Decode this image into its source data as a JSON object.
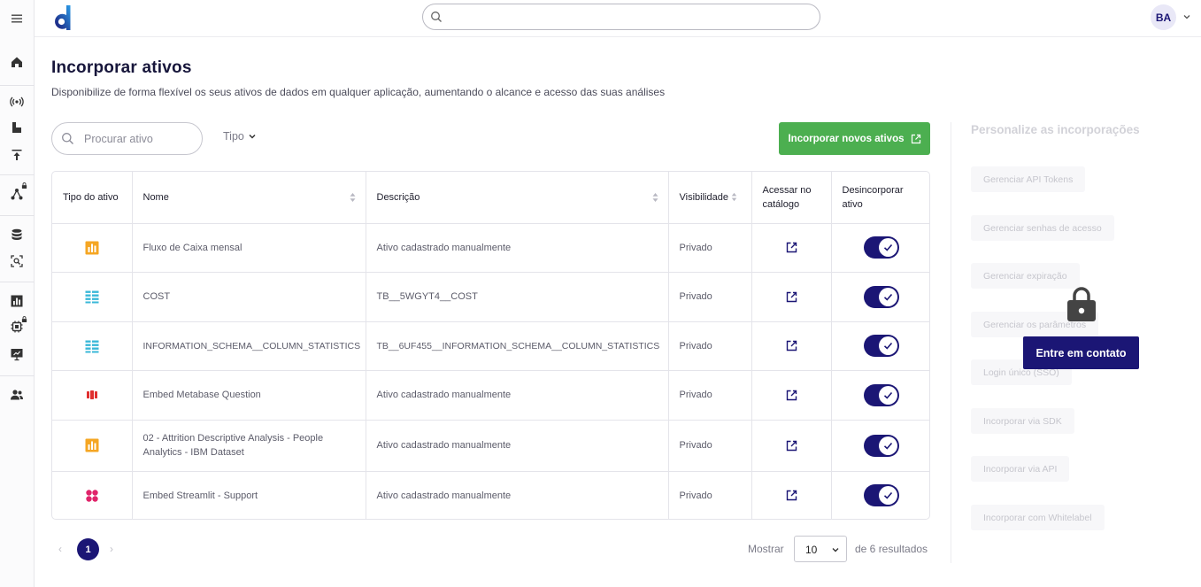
{
  "search": {
    "placeholder": ""
  },
  "user": {
    "initials": "BA"
  },
  "page": {
    "title": "Incorporar ativos",
    "subtitle": "Disponibilize de forma flexível os seus ativos de dados em qualquer aplicação, aumentando o alcance e acesso das suas análises"
  },
  "filters": {
    "search_placeholder": "Procurar ativo",
    "type_label": "Tipo",
    "new_button": "Incorporar novos ativos"
  },
  "table": {
    "headers": {
      "type": "Tipo do ativo",
      "name": "Nome",
      "description": "Descrição",
      "visibility": "Visibilidade",
      "catalog": "Acessar no catálogo",
      "unembed": "Desincorporar ativo"
    },
    "rows": [
      {
        "type_icon": "bar-chart-icon",
        "type_color": "#f5a623",
        "name": "Fluxo de Caixa mensal",
        "description": "Ativo cadastrado manualmente",
        "visibility": "Privado",
        "embedded": true
      },
      {
        "type_icon": "table-icon",
        "type_color": "#3bb8d8",
        "name": "COST",
        "description": "TB__5WGYT4__COST",
        "visibility": "Privado",
        "embedded": true
      },
      {
        "type_icon": "table-icon",
        "type_color": "#3bb8d8",
        "name": "INFORMATION_SCHEMA__COLUMN_STATISTICS",
        "description": "TB__6UF455__INFORMATION_SCHEMA__COLUMN_STATISTICS",
        "visibility": "Privado",
        "embedded": true
      },
      {
        "type_icon": "metabase-icon",
        "type_color": "#e02f2f",
        "name": "Embed Metabase Question",
        "description": "Ativo cadastrado manualmente",
        "visibility": "Privado",
        "embedded": true
      },
      {
        "type_icon": "bar-chart-icon",
        "type_color": "#f5a623",
        "name": "02 - Attrition Descriptive Analysis - People Analytics - IBM Dataset",
        "description": "Ativo cadastrado manualmente",
        "visibility": "Privado",
        "embedded": true
      },
      {
        "type_icon": "streamlit-icon",
        "type_color": "#e0246a",
        "name": "Embed Streamlit - Support",
        "description": "Ativo cadastrado manualmente",
        "visibility": "Privado",
        "embedded": true
      }
    ]
  },
  "pagination": {
    "prev": "‹",
    "current_page": "1",
    "next": "›",
    "show_label": "Mostrar",
    "page_size": "10",
    "results_label": "de 6 resultados"
  },
  "right_panel": {
    "title": "Personalize as incorporações",
    "items": [
      "Gerenciar API Tokens",
      "Gerenciar senhas de acesso",
      "Gerenciar expiração",
      "Gerenciar os parâmetros",
      "Login único (SSO)",
      "Incorporar via SDK",
      "Incorporar via API",
      "Incorporar com Whitelabel"
    ],
    "contact_button": "Entre em contato"
  },
  "colors": {
    "brand": "#1b1675",
    "success": "#4caf50",
    "logo_blue": "#2a7de1"
  }
}
